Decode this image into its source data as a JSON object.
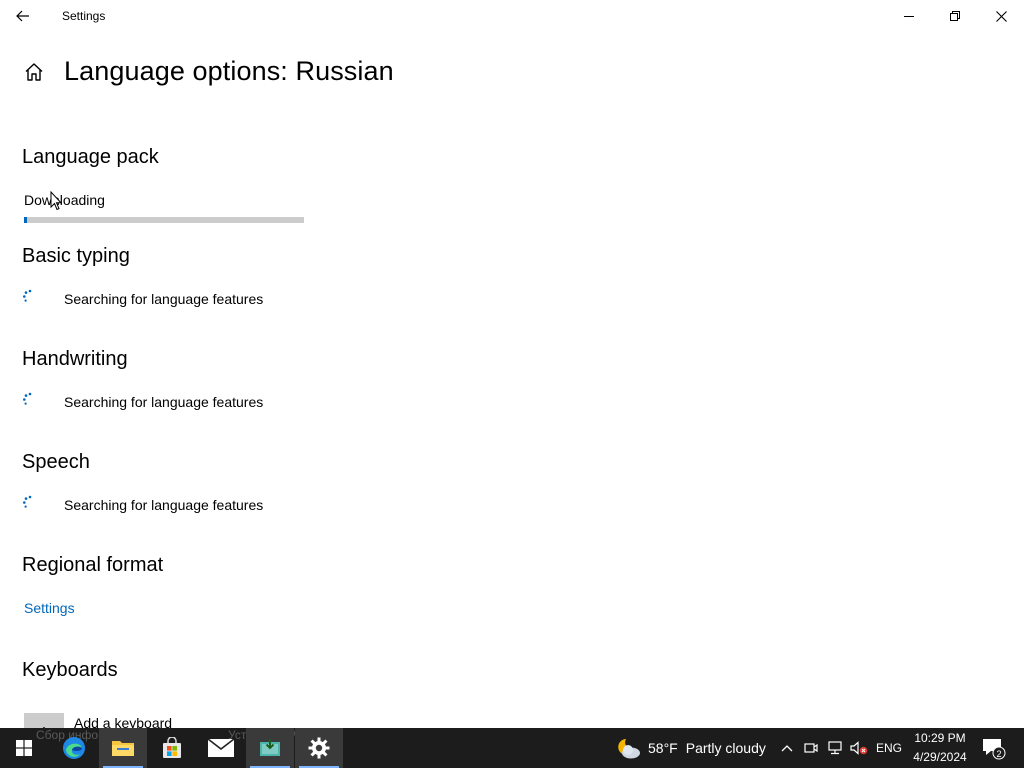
{
  "titlebar": {
    "title": "Settings"
  },
  "page": {
    "title": "Language options: Russian"
  },
  "language_pack": {
    "heading": "Language pack",
    "status": "Downloading",
    "progress_percent": 1
  },
  "basic_typing": {
    "heading": "Basic typing",
    "status": "Searching for language features"
  },
  "handwriting": {
    "heading": "Handwriting",
    "status": "Searching for language features"
  },
  "speech": {
    "heading": "Speech",
    "status": "Searching for language features"
  },
  "regional_format": {
    "heading": "Regional format",
    "link": "Settings"
  },
  "keyboards": {
    "heading": "Keyboards",
    "add_label": "Add a keyboard",
    "add_symbol": "+"
  },
  "taskbar": {
    "ghost_left": "Сбор информации",
    "ghost_right": "Установка Windows",
    "weather_temp": "58°F",
    "weather_desc": "Partly cloudy",
    "lang": "ENG",
    "time": "10:29 PM",
    "date": "4/29/2024",
    "notifications": "2"
  },
  "colors": {
    "accent": "#0067c0",
    "link": "#0067b8",
    "taskbar": "#1c1c1c"
  }
}
